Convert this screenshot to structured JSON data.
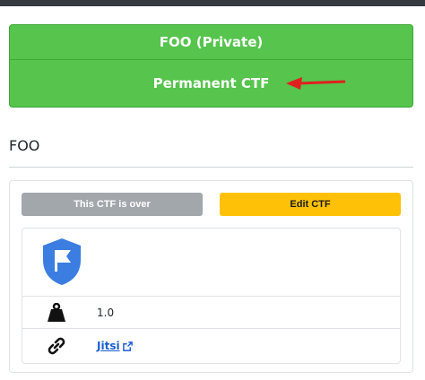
{
  "banner": {
    "title": "FOO (Private)",
    "subtitle": "Permanent CTF"
  },
  "section": {
    "title": "FOO"
  },
  "card": {
    "status_label": "This CTF is over",
    "edit_label": "Edit CTF",
    "weight_value": "1.0",
    "link_label": "Jitsi"
  },
  "icons": {
    "shield": "flag-shield-icon",
    "weight": "weight-icon",
    "link": "link-icon",
    "external": "external-link-icon",
    "arrow": "red-arrow-annotation"
  },
  "colors": {
    "banner_green": "#56c44d",
    "edit_yellow": "#ffc107",
    "disabled_gray": "#a2a7ac",
    "shield_blue": "#3b7de0",
    "link_blue": "#1a5fd6",
    "arrow_red": "#e02020"
  }
}
